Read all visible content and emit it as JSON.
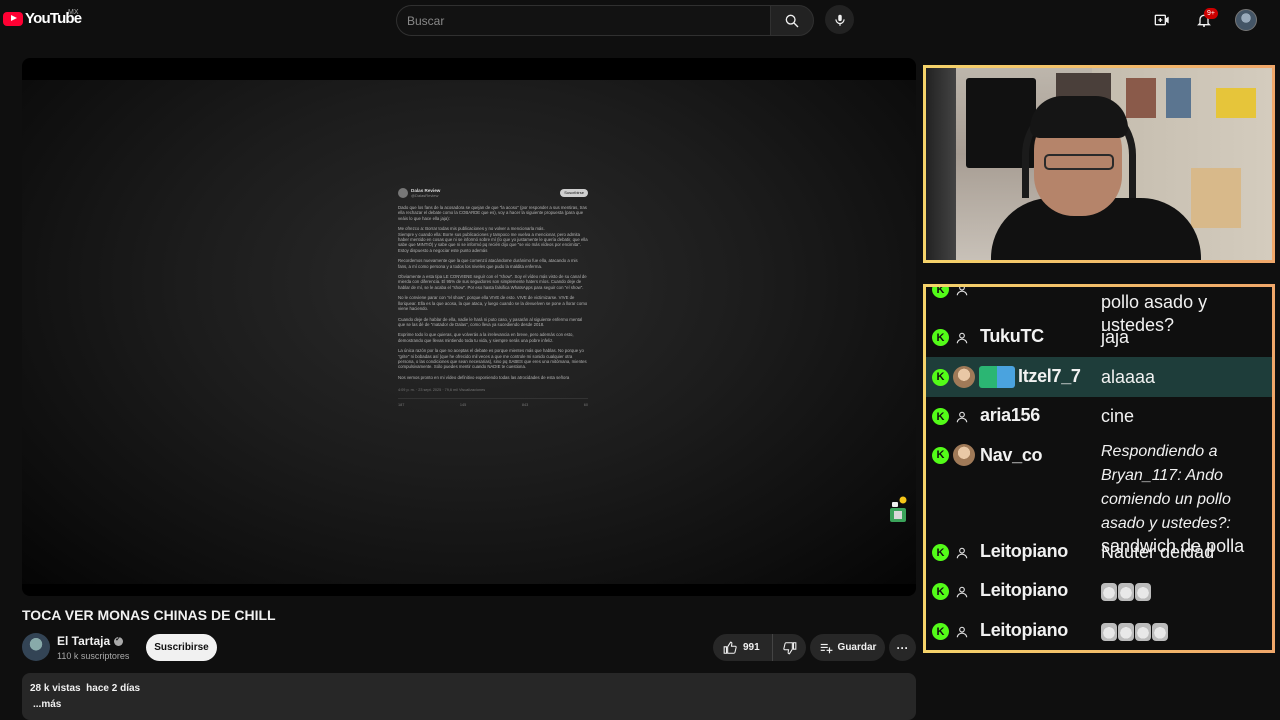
{
  "header": {
    "logo_text": "YouTube",
    "country": "MX",
    "search_placeholder": "Buscar",
    "notifications_badge": "9+"
  },
  "video": {
    "title": "TOCA VER MONAS CHINAS DE CHILL",
    "channel_name": "El Tartaja",
    "subscribers": "110 k suscriptores",
    "subscribe_label": "Suscribirse",
    "likes": "991",
    "save_label": "Guardar",
    "more_label": "···",
    "views": "28 k vistas",
    "date": "hace 2 días",
    "show_more": "...más"
  },
  "tweet": {
    "name": "Dalas Review",
    "handle": "@DalasReview",
    "subscribe": "Suscribirse",
    "paragraphs": [
      "Dado que los fans de la acosadora se quejan de que \"la acoso\" (por responder a sus mentiras, tras ella rechazar el debate como la COBARDE que es), voy a hacer la siguiente propuesta (para que veáis lo que hace ella jaja):",
      "Me ofrezco a: Borrar todas mis publicaciones y no volver a mencionarla más.\nSiempre y cuando ella: Borre sus publicaciones y tampoco me vuelva a mencionar, pero admita haber mentido en cosas que ni se informó sobre mí (lo que yo justamente le quería debatir, que ella sabe que MINTIÓ) y sabe que ni se informó pq recién dijo que \"se vio más vídeos por encimita\". Estoy dispuesto a negociar este punto además",
      "Recordemos nuevamente que la que comenzó atacándome duránimo fue ella, atacando a mis fans, a mí como persona y a todos los niveles que pudo la maldita enferma.",
      "Obviamente a esta tipa LE CONVIENE seguir con el \"show\". Soy el vídeo más visto de su canal de mierda con diferencia. El 95% de sus seguidores son simplemente haters míos. Cuando deje de hablar de mí, se le acaba el \"show\". Por eso hasta falsifica WhatsApps para seguir con \"el show\".",
      "No le conviene parar con \"el show\", porque ella VIVE de esto. VIVE de victimizarse. VIVE de lloriquear. Ella es la que acosa, la que ataca, y luego cuando se la devuelven se pone a llorar como viene haciendo.",
      "Cuando deje de hablar de ella, nadie le hará ni puto caso, y pasarán al siguiente enfermo mental que se las dé de \"matador de Dalas\", como lleva ya sucediendo desde 2018.",
      "Exprime todo lo que quieras, que volverás a la irrelevancia en breve, pero además con esto, demostrando que llevas mintiendo toda tu vida, y siempre serás una pobre infeliz.",
      "La única razón por la que no aceptas el debate es porque mientes más que hablas. No porque yo \"grite\" ni bobadas así (que he ofrecido mil veces a que me controle mi sonido cualquier otra persona, o las condiciones que sean necesarias), sino pq SABES que eres una mitómana, mientes compulsivamente. Sólo puedes mentir cuando NADIE te cuestiona.",
      "Nos vemos pronto en mi vídeo definitivo exponiendo todas las atrocidades de esta señora"
    ],
    "meta": "4:09 p. m. · 23 sept. 2025 · 79,6 mil Visualizaciones",
    "actions": [
      "187",
      "145",
      "843",
      "60"
    ]
  },
  "chat": {
    "messages": [
      {
        "user": "",
        "text": "pollo asado y ustedes?",
        "type": "partial"
      },
      {
        "user": "TukuTC",
        "text": "jaja",
        "type": "plain"
      },
      {
        "user": "Itzel7_7",
        "text": "alaaaa",
        "type": "highlight"
      },
      {
        "user": "aria156",
        "text": "cine",
        "type": "plain"
      },
      {
        "user": "Nav_co",
        "reply": "Respondiendo a Bryan_117: Ando comiendo un pollo asado y ustedes?:",
        "text": "sandwich de polla",
        "type": "reply"
      },
      {
        "user": "Leitopiano",
        "text": "Nauter deidad",
        "type": "plain"
      },
      {
        "user": "Leitopiano",
        "text": "",
        "emotes": 3,
        "type": "emote"
      },
      {
        "user": "Leitopiano",
        "text": "",
        "emotes": 4,
        "type": "emote"
      }
    ]
  },
  "colors": {
    "overlay_border_start": "#f5d36a",
    "overlay_border_end": "#f0a76a",
    "kick_green": "#53fc18",
    "highlight_row": "#1e3d3a",
    "youtube_red": "#ff0033"
  },
  "icons": [
    "youtube-logo-icon",
    "search-icon",
    "mic-icon",
    "create-icon",
    "bell-icon",
    "like-icon",
    "dislike-icon",
    "save-playlist-icon",
    "kick-badge-icon",
    "user-icon"
  ]
}
